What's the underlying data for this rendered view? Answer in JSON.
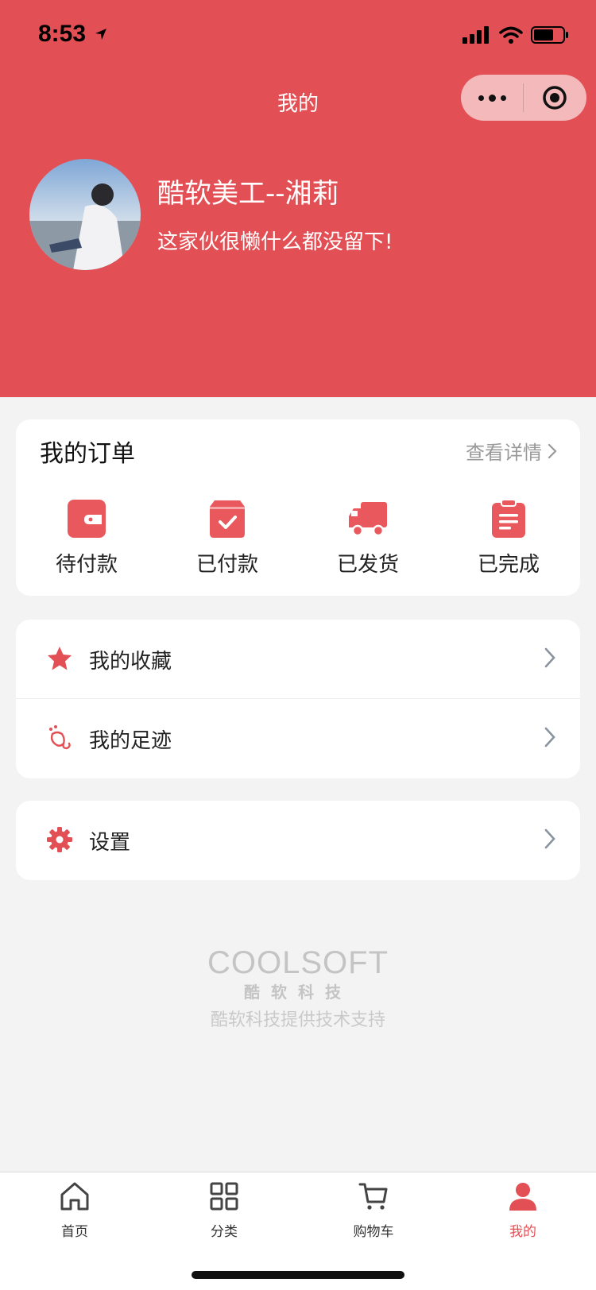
{
  "status_bar": {
    "time": "8:53"
  },
  "nav": {
    "title": "我的"
  },
  "colors": {
    "primary": "#e25055",
    "background": "#f3f3f3"
  },
  "user": {
    "name": "酷软美工--湘莉",
    "bio": "这家伙很懒什么都没留下!"
  },
  "orders": {
    "title": "我的订单",
    "detail_label": "查看详情",
    "items": [
      {
        "label": "待付款",
        "icon": "wallet-icon"
      },
      {
        "label": "已付款",
        "icon": "box-check-icon"
      },
      {
        "label": "已发货",
        "icon": "truck-icon"
      },
      {
        "label": "已完成",
        "icon": "clipboard-icon"
      }
    ]
  },
  "menu": {
    "favorites": {
      "label": "我的收藏",
      "icon": "star-icon"
    },
    "footprints": {
      "label": "我的足迹",
      "icon": "footprint-icon"
    },
    "settings": {
      "label": "设置",
      "icon": "gear-icon"
    }
  },
  "brand": {
    "logo": "COOLSOFT",
    "sub": "酷软科技",
    "note": "酷软科技提供技术支持"
  },
  "tabbar": {
    "items": [
      {
        "label": "首页",
        "icon": "home-icon"
      },
      {
        "label": "分类",
        "icon": "grid-icon"
      },
      {
        "label": "购物车",
        "icon": "cart-icon"
      },
      {
        "label": "我的",
        "icon": "user-icon",
        "active": true
      }
    ]
  }
}
